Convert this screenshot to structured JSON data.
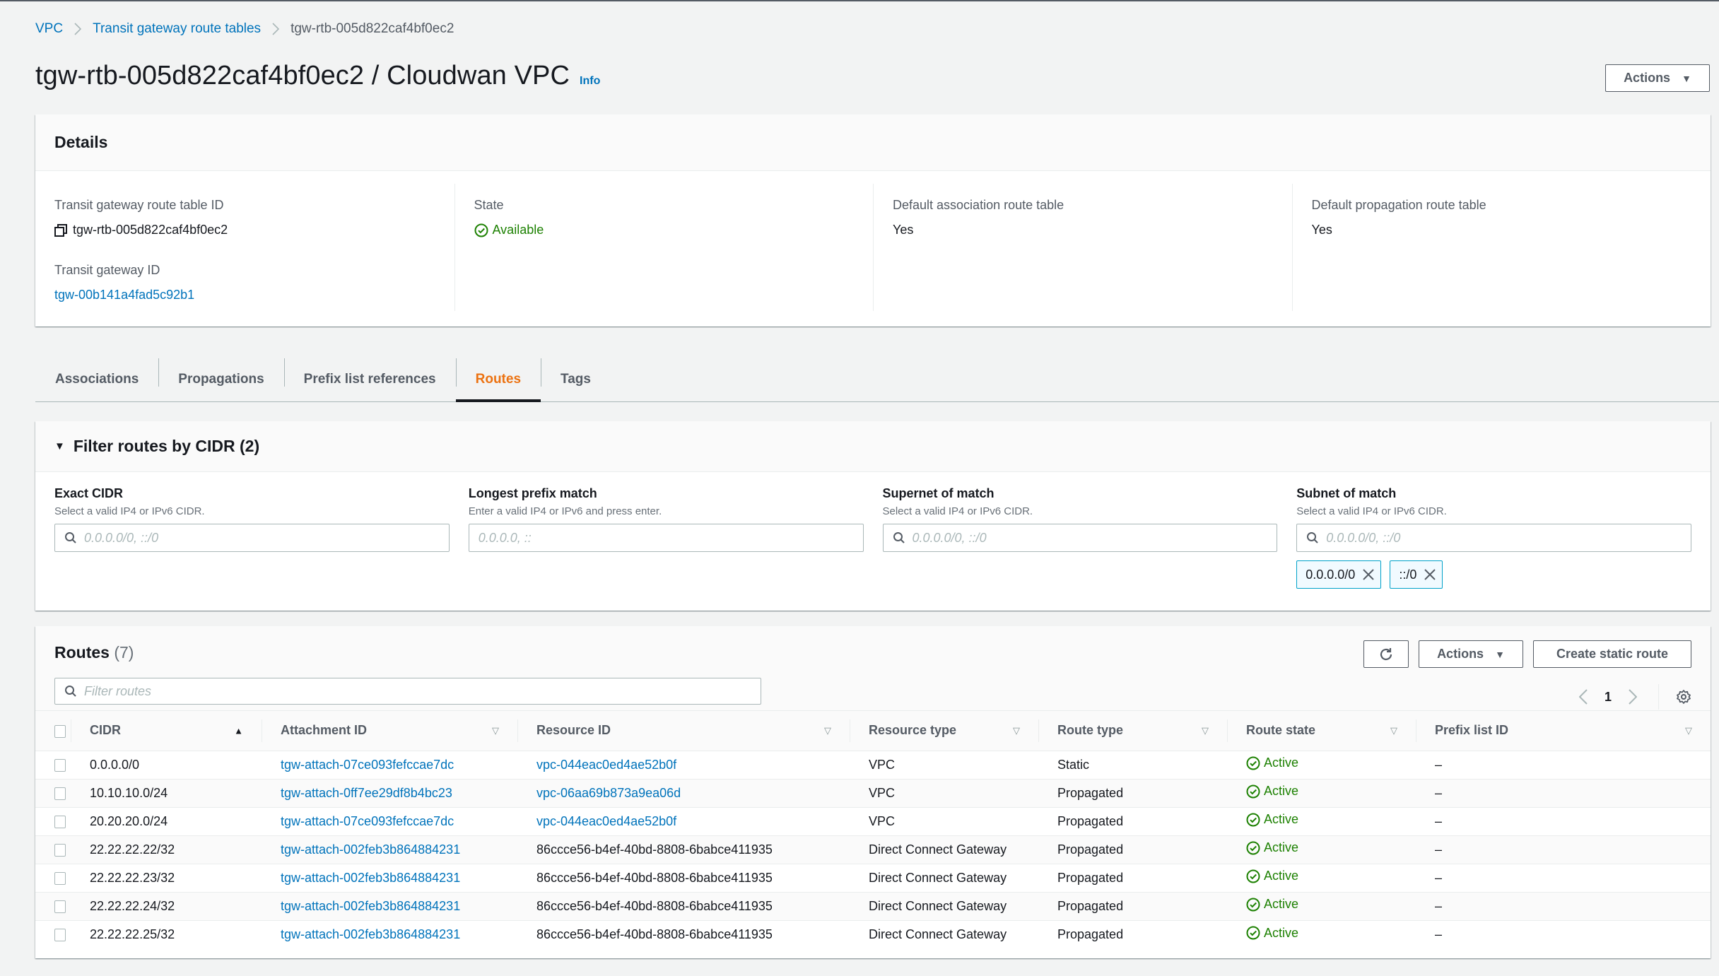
{
  "breadcrumb": [
    {
      "label": "VPC",
      "link": true
    },
    {
      "label": "Transit gateway route tables",
      "link": true
    },
    {
      "label": "tgw-rtb-005d822caf4bf0ec2",
      "link": false
    }
  ],
  "header": {
    "title": "tgw-rtb-005d822caf4bf0ec2 / Cloudwan VPC",
    "info": "Info",
    "actions_label": "Actions"
  },
  "details": {
    "title": "Details",
    "route_table_id_label": "Transit gateway route table ID",
    "route_table_id": "tgw-rtb-005d822caf4bf0ec2",
    "transit_gateway_id_label": "Transit gateway ID",
    "transit_gateway_id": "tgw-00b141a4fad5c92b1",
    "state_label": "State",
    "state": "Available",
    "default_association_label": "Default association route table",
    "default_association": "Yes",
    "default_propagation_label": "Default propagation route table",
    "default_propagation": "Yes"
  },
  "tabs": [
    {
      "label": "Associations",
      "active": false
    },
    {
      "label": "Propagations",
      "active": false
    },
    {
      "label": "Prefix list references",
      "active": false
    },
    {
      "label": "Routes",
      "active": true
    },
    {
      "label": "Tags",
      "active": false
    }
  ],
  "filter": {
    "title": "Filter routes by CIDR (2)",
    "fields": [
      {
        "label": "Exact CIDR",
        "description": "Select a valid IP4 or IPv6 CIDR.",
        "placeholder": "0.0.0.0/0, ::/0",
        "value": ""
      },
      {
        "label": "Longest prefix match",
        "description": "Enter a valid IP4 or IPv6 and press enter.",
        "placeholder": "0.0.0.0, ::",
        "value": ""
      },
      {
        "label": "Supernet of match",
        "description": "Select a valid IP4 or IPv6 CIDR.",
        "placeholder": "0.0.0.0/0, ::/0",
        "value": ""
      },
      {
        "label": "Subnet of match",
        "description": "Select a valid IP4 or IPv6 CIDR.",
        "placeholder": "0.0.0.0/0, ::/0",
        "value": ""
      }
    ],
    "subnet_tokens": [
      "0.0.0.0/0",
      "::/0"
    ]
  },
  "routes": {
    "title": "Routes",
    "count": "(7)",
    "actions_label": "Actions",
    "create_label": "Create static route",
    "filter_placeholder": "Filter routes",
    "page": "1",
    "columns": [
      "CIDR",
      "Attachment ID",
      "Resource ID",
      "Resource type",
      "Route type",
      "Route state",
      "Prefix list ID"
    ],
    "rows": [
      {
        "cidr": "0.0.0.0/0",
        "attachment": "tgw-attach-07ce093fefccae7dc",
        "resource": "vpc-044eac0ed4ae52b0f",
        "resource_link": true,
        "resource_type": "VPC",
        "route_type": "Static",
        "state": "Active",
        "prefix": "–"
      },
      {
        "cidr": "10.10.10.0/24",
        "attachment": "tgw-attach-0ff7ee29df8b4bc23",
        "resource": "vpc-06aa69b873a9ea06d",
        "resource_link": true,
        "resource_type": "VPC",
        "route_type": "Propagated",
        "state": "Active",
        "prefix": "–"
      },
      {
        "cidr": "20.20.20.0/24",
        "attachment": "tgw-attach-07ce093fefccae7dc",
        "resource": "vpc-044eac0ed4ae52b0f",
        "resource_link": true,
        "resource_type": "VPC",
        "route_type": "Propagated",
        "state": "Active",
        "prefix": "–"
      },
      {
        "cidr": "22.22.22.22/32",
        "attachment": "tgw-attach-002feb3b864884231",
        "resource": "86ccce56-b4ef-40bd-8808-6babce411935",
        "resource_link": false,
        "resource_type": "Direct Connect Gateway",
        "route_type": "Propagated",
        "state": "Active",
        "prefix": "–"
      },
      {
        "cidr": "22.22.22.23/32",
        "attachment": "tgw-attach-002feb3b864884231",
        "resource": "86ccce56-b4ef-40bd-8808-6babce411935",
        "resource_link": false,
        "resource_type": "Direct Connect Gateway",
        "route_type": "Propagated",
        "state": "Active",
        "prefix": "–"
      },
      {
        "cidr": "22.22.22.24/32",
        "attachment": "tgw-attach-002feb3b864884231",
        "resource": "86ccce56-b4ef-40bd-8808-6babce411935",
        "resource_link": false,
        "resource_type": "Direct Connect Gateway",
        "route_type": "Propagated",
        "state": "Active",
        "prefix": "–"
      },
      {
        "cidr": "22.22.22.25/32",
        "attachment": "tgw-attach-002feb3b864884231",
        "resource": "86ccce56-b4ef-40bd-8808-6babce411935",
        "resource_link": false,
        "resource_type": "Direct Connect Gateway",
        "route_type": "Propagated",
        "state": "Active",
        "prefix": "–"
      }
    ]
  },
  "colors": {
    "link": "#0073bb",
    "active_tab": "#ec7211",
    "success": "#1d8102",
    "token_border": "#00a1c9"
  }
}
